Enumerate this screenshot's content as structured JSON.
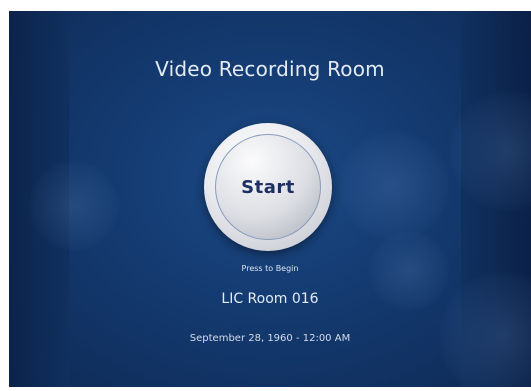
{
  "screen": {
    "title": "Video Recording Room",
    "start_button_label": "Start",
    "hint": "Press to Begin",
    "room_name": "LIC Room 016",
    "datetime": "September 28, 1960 - 12:00 AM"
  },
  "colors": {
    "background": "#143a70",
    "text": "#e3ebf5",
    "button_label": "#1d2f63"
  }
}
